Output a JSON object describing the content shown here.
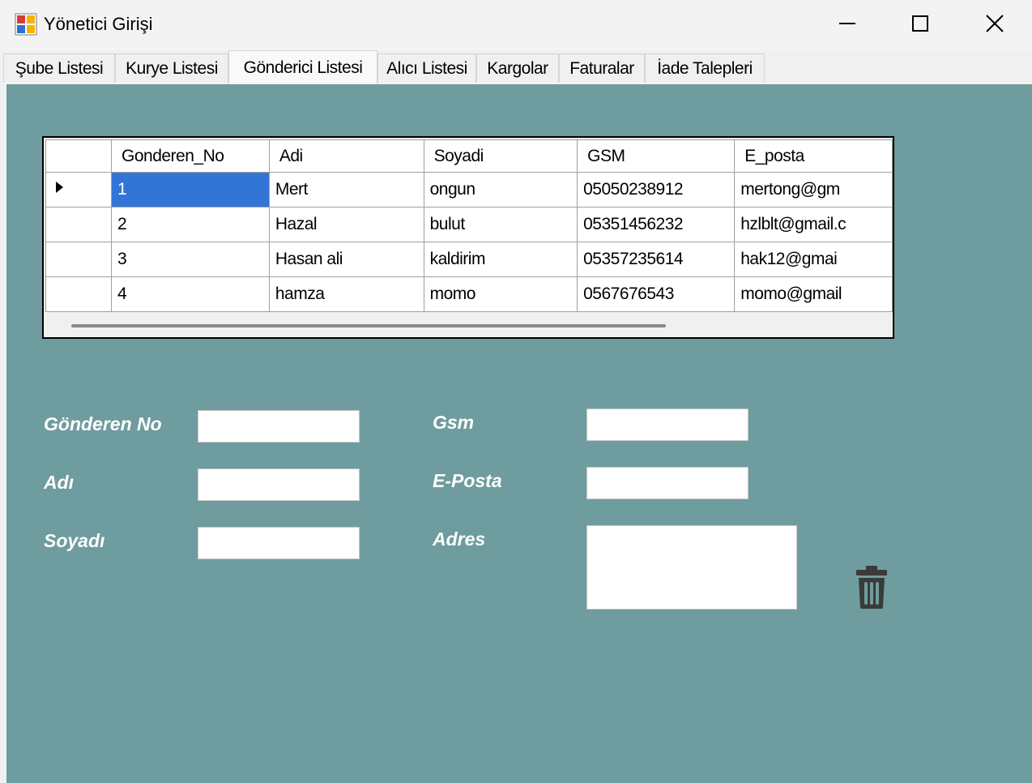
{
  "window": {
    "title": "Yönetici Girişi"
  },
  "tabs": [
    {
      "label": "Şube Listesi"
    },
    {
      "label": "Kurye Listesi"
    },
    {
      "label": "Gönderici Listesi"
    },
    {
      "label": "Alıcı Listesi"
    },
    {
      "label": "Kargolar"
    },
    {
      "label": "Faturalar"
    },
    {
      "label": "İade Talepleri"
    }
  ],
  "grid": {
    "columns": [
      "Gonderen_No",
      "Adi",
      "Soyadi",
      "GSM",
      "E_posta"
    ],
    "rows": [
      [
        "1",
        "Mert",
        "ongun",
        "05050238912",
        "mertong@gm"
      ],
      [
        "2",
        "Hazal",
        "bulut",
        "05351456232",
        "hzlblt@gmail.c"
      ],
      [
        "3",
        "Hasan ali",
        "kaldirim",
        "05357235614",
        "hak12@gmai"
      ],
      [
        "4",
        "hamza",
        "momo",
        "0567676543",
        "momo@gmail"
      ]
    ]
  },
  "form": {
    "gonderen_no_label": "Gönderen No",
    "adi_label": "Adı",
    "soyadi_label": "Soyadı",
    "gsm_label": "Gsm",
    "eposta_label": "E-Posta",
    "adres_label": "Adres",
    "gonderen_no_value": "",
    "adi_value": "",
    "soyadi_value": "",
    "gsm_value": "",
    "eposta_value": "",
    "adres_value": ""
  },
  "icons": {
    "app": "app-icon",
    "minimize": "minimize-icon",
    "maximize": "maximize-icon",
    "close": "close-icon",
    "delete": "trash-icon"
  },
  "colors": {
    "panel_background": "#6f9c9e",
    "selected_cell": "#3375d7",
    "trash_icon": "#3a3a3a"
  }
}
